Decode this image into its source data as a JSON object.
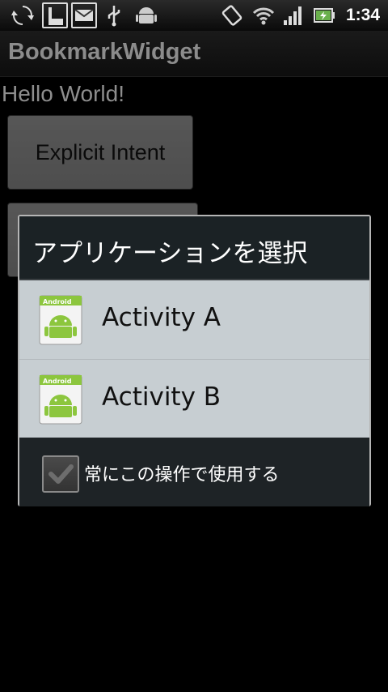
{
  "status_bar": {
    "time": "1:34",
    "icons": [
      "sync-icon",
      "mail-icon",
      "envelope-icon",
      "usb-icon",
      "android-debug-icon",
      "screen-rotate-icon",
      "wifi-icon",
      "signal-icon",
      "battery-icon"
    ]
  },
  "app": {
    "title": "BookmarkWidget",
    "hello": "Hello World!",
    "explicit_button": "Explicit Intent"
  },
  "dialog": {
    "title": "アプリケーションを選択",
    "items": [
      {
        "label": "Activity A",
        "icon": "android-app-icon"
      },
      {
        "label": "Activity B",
        "icon": "android-app-icon"
      }
    ],
    "icon_caption": "Android",
    "checkbox_label": "常にこの操作で使用する",
    "checkbox_checked": true
  },
  "colors": {
    "dialog_list_bg": "#c7ced2",
    "dialog_bg": "#1e2326",
    "android_green": "#8cc63e"
  }
}
